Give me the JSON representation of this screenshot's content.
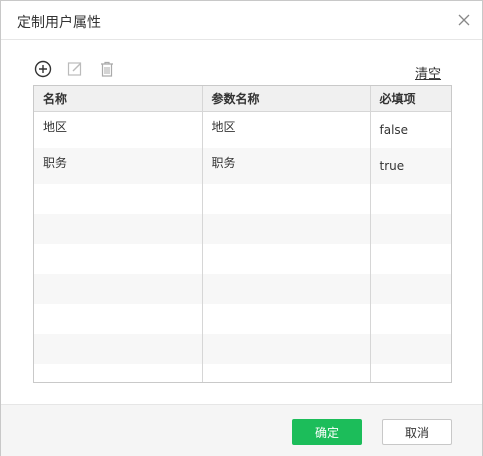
{
  "dialog": {
    "title": "定制用户属性",
    "close_icon": "close-icon"
  },
  "toolbar": {
    "add_icon": "add-circle-icon",
    "edit_icon": "edit-icon",
    "delete_icon": "trash-icon",
    "clear_label": "清空"
  },
  "table": {
    "columns": [
      "名称",
      "参数名称",
      "必填项"
    ],
    "rows": [
      [
        "地区",
        "地区",
        "false"
      ],
      [
        "职务",
        "职务",
        "true"
      ],
      [
        "",
        "",
        ""
      ],
      [
        "",
        "",
        ""
      ],
      [
        "",
        "",
        ""
      ],
      [
        "",
        "",
        ""
      ],
      [
        "",
        "",
        ""
      ],
      [
        "",
        "",
        ""
      ],
      [
        "",
        "",
        ""
      ]
    ]
  },
  "footer": {
    "ok_label": "确定",
    "cancel_label": "取消"
  },
  "colors": {
    "primary_button": "#1cbd5a",
    "header_bg": "#f0f0f0",
    "alt_row": "#f7f7f7"
  }
}
